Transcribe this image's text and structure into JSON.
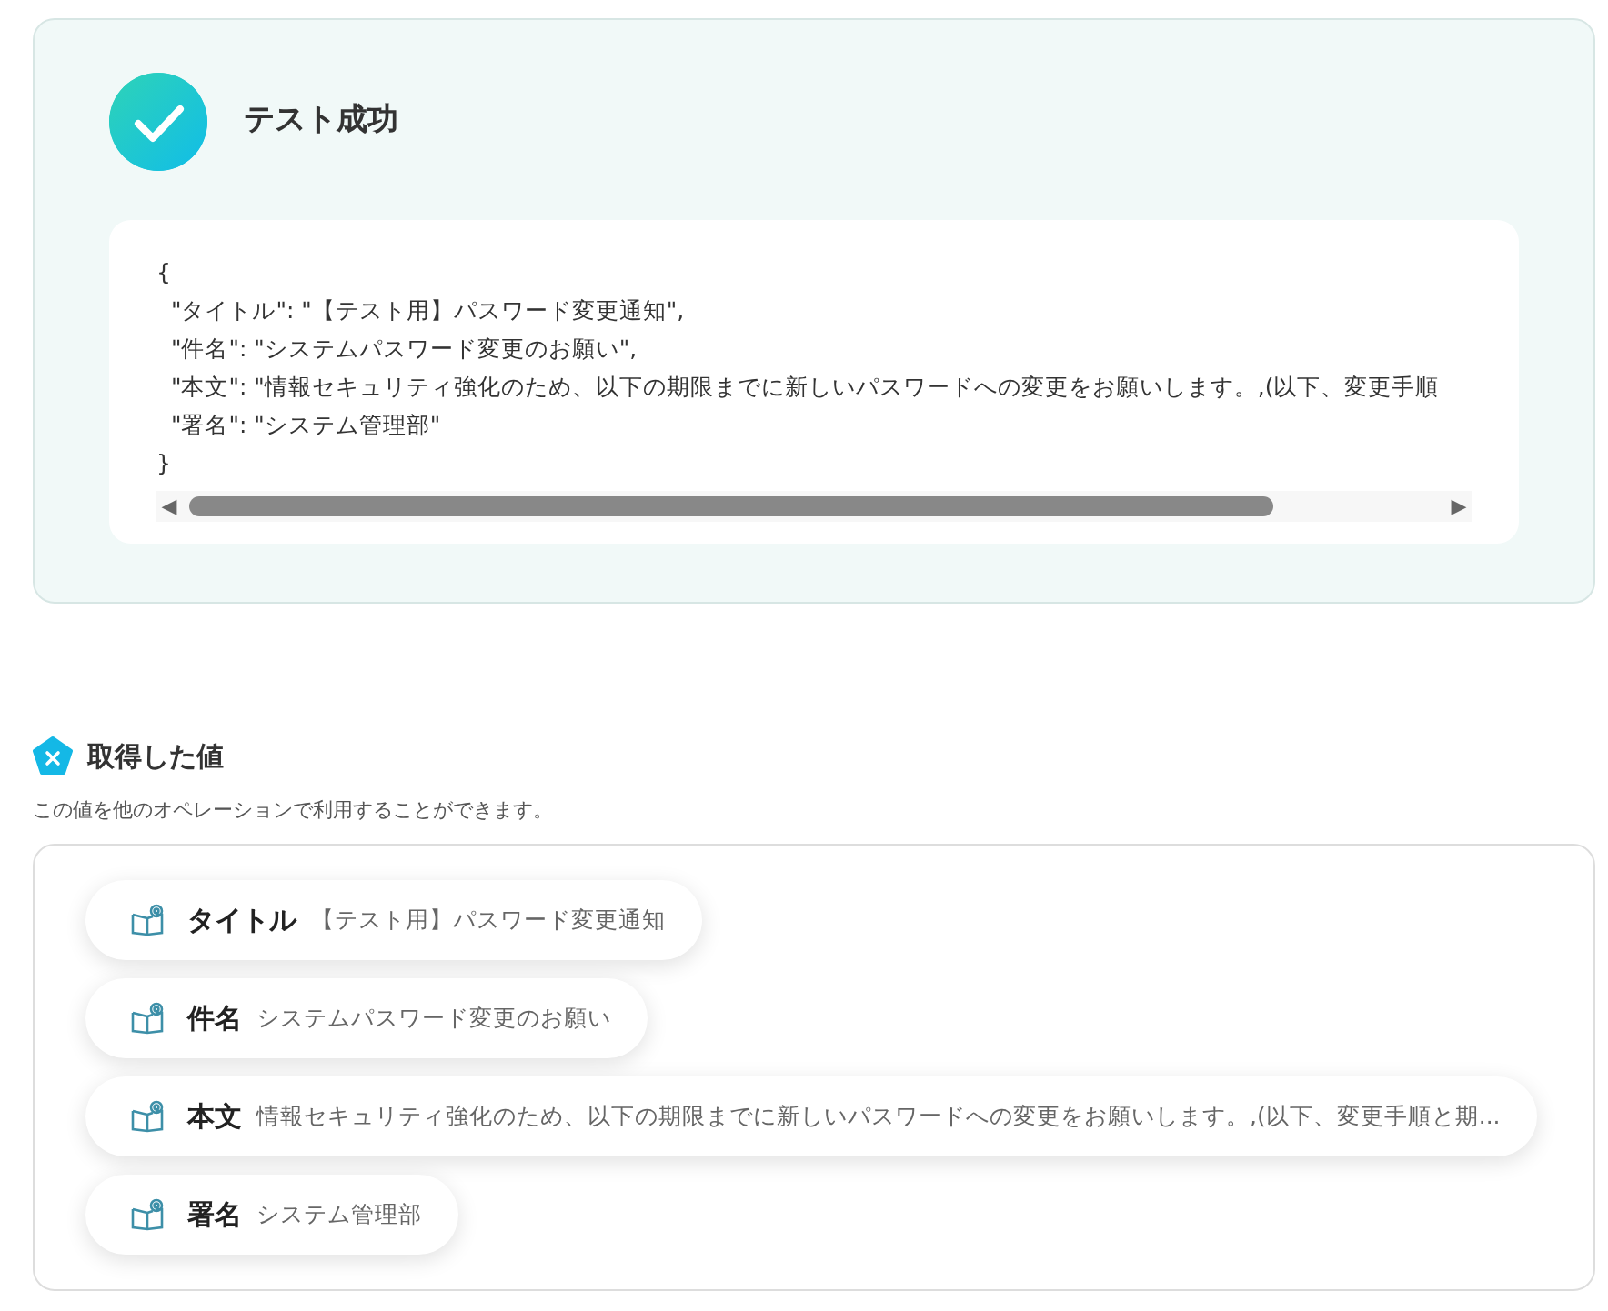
{
  "result": {
    "title": "テスト成功",
    "code_lines": [
      "{",
      "  \"タイトル\": \"【テスト用】パスワード変更通知\",",
      "  \"件名\": \"システムパスワード変更のお願い\",",
      "  \"本文\": \"情報セキュリティ強化のため、以下の期限までに新しいパスワードへの変更をお願いします。,(以下、変更手順",
      "  \"署名\": \"システム管理部\"",
      "}"
    ],
    "scroll_left": "◀",
    "scroll_right": "▶"
  },
  "values": {
    "title": "取得した値",
    "description": "この値を他のオペレーションで利用することができます。",
    "items": [
      {
        "label": "タイトル",
        "value": "【テスト用】パスワード変更通知"
      },
      {
        "label": "件名",
        "value": "システムパスワード変更のお願い"
      },
      {
        "label": "本文",
        "value": "情報セキュリティ強化のため、以下の期限までに新しいパスワードへの変更をお願いします。,(以下、変更手順と期..."
      },
      {
        "label": "署名",
        "value": "システム管理部"
      }
    ]
  }
}
